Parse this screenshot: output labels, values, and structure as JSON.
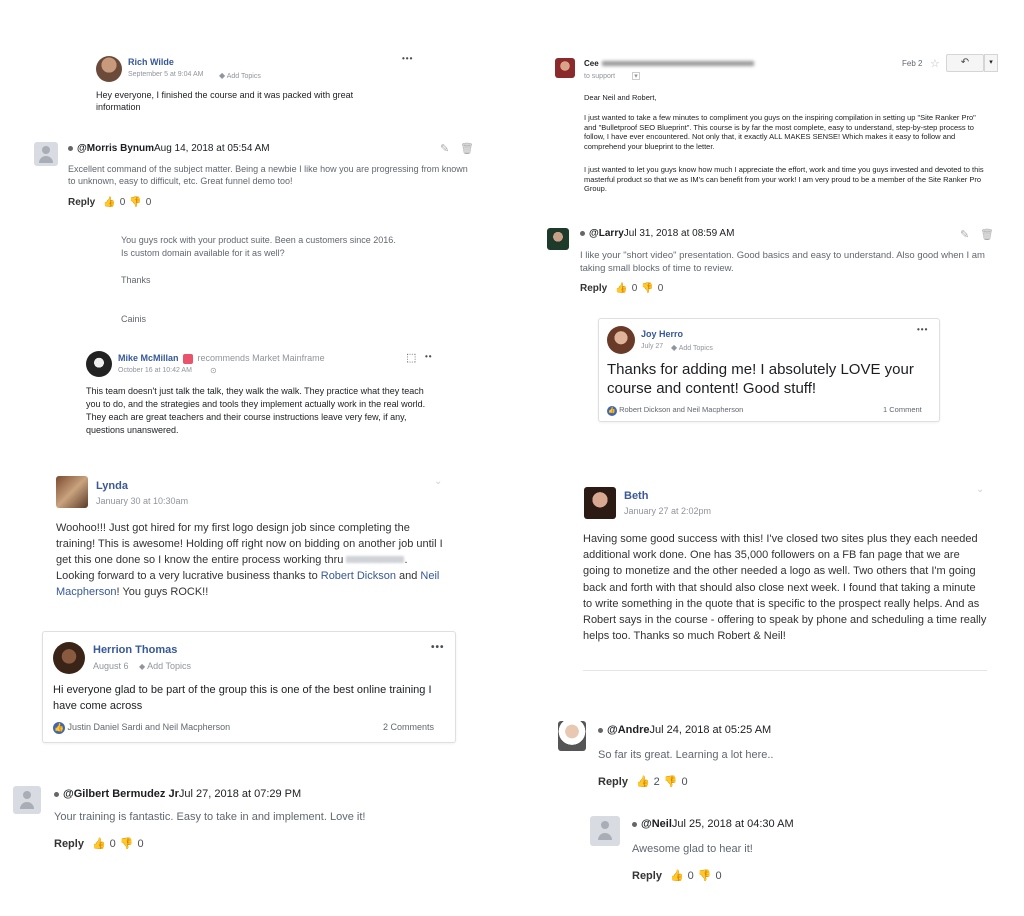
{
  "colors": {
    "fb_blue": "#365899",
    "meta_gray": "#90949c",
    "like_blue": "#4267b2"
  },
  "rich_wilde": {
    "name": "Rich Wilde",
    "date": "September 5 at 9:04 AM",
    "add_topics": "Add Topics",
    "menu": "•••",
    "body": "Hey everyone, I finished the course and it was packed with great information"
  },
  "morris": {
    "handle": "@Morris Bynum",
    "date": "Aug 14, 2018 at 05:54 AM",
    "body": "Excellent command of the subject matter. Being a newbie I like how you are progressing from known to unknown, easy to difficult, etc. Great funnel demo too!",
    "reply": "Reply",
    "likes": "0",
    "dislikes": "0"
  },
  "cainis": {
    "line1": "You guys rock with your product suite. Been a customers since 2016.",
    "line2": "Is custom domain available for it as well?",
    "thanks": "Thanks",
    "signature": "Cainis"
  },
  "mike": {
    "name": "Mike McMillan",
    "recommends": "recommends Market Mainframe",
    "date": "October 16 at 10:42 AM",
    "menu": "••",
    "body": "This team doesn't just talk the talk, they walk the walk. They practice what they teach you to do, and the strategies and tools they implement actually work in the real world. They each are great teachers and their course instructions leave very few, if any, questions unanswered."
  },
  "lynda": {
    "name": "Lynda",
    "date": "January 30 at 10:30am",
    "body_start": "Woohoo!!! Just got hired for my first logo design job since completing the training! This is awesome! Holding off right now on bidding on another job until I get this one done so I know the entire process working thru",
    "body_mid": ". Looking forward to a very lucrative business thanks to ",
    "link1": "Robert Dickson",
    "and": " and ",
    "link2": "Neil Macpherson",
    "body_end": "! You guys ROCK!!"
  },
  "herrion": {
    "name": "Herrion Thomas",
    "date": "August 6",
    "add_topics": "Add Topics",
    "menu": "•••",
    "body": "Hi everyone glad to be part of the group this is one of the best online training I have come across",
    "likers": "Justin Daniel Sardi and Neil Macpherson",
    "comments": "2 Comments"
  },
  "gilbert": {
    "handle": "@Gilbert Bermudez Jr",
    "date": "Jul 27, 2018 at 07:29 PM",
    "body": "Your training is fantastic. Easy to take in and implement. Love it!",
    "reply": "Reply",
    "likes": "0",
    "dislikes": "0"
  },
  "email": {
    "from": "Cee",
    "to": "to support",
    "date": "Feb 2",
    "greeting": "Dear Neil and Robert,",
    "para1": "I just wanted to take a few minutes to compliment you guys on the inspiring compilation in setting up \"Site Ranker Pro\" and \"Bulletproof SEO Blueprint\". This course is by far the most complete, easy to understand, step-by-step process to follow, I have ever encountered. Not only that, it exactly ALL MAKES SENSE! Which makes it easy to follow and comprehend your blueprint to the letter.",
    "para2": "I just wanted to let you guys know how much I appreciate the effort, work and time you guys invested and devoted to this masterful product so that we as IM's can benefit from your work! I am very proud to be a member of the Site Ranker Pro Group."
  },
  "larry": {
    "handle": "@Larry",
    "date": "Jul 31, 2018 at 08:59 AM",
    "body": "I like your \"short video\" presentation. Good basics and easy to understand. Also good when I am taking small blocks of time to review.",
    "reply": "Reply",
    "likes": "0",
    "dislikes": "0"
  },
  "joy": {
    "name": "Joy Herro",
    "date": "July 27",
    "add_topics": "Add Topics",
    "menu": "•••",
    "body": "Thanks for adding me! I absolutely LOVE your course and content! Good stuff!",
    "likers": "Robert Dickson and Neil Macpherson",
    "comments": "1 Comment"
  },
  "beth": {
    "name": "Beth",
    "date": "January 27 at 2:02pm",
    "body": "Having some good success with this! I've closed two sites plus they each needed additional work done. One has 35,000 followers on a FB fan page that we are going to monetize and the other needed a logo as well. Two others that I'm going back and forth with that should also close next week. I found that taking a minute to write something in the quote that is specific to the prospect really helps. And as Robert says in the course - offering to speak by phone and scheduling a time really helps too. Thanks so much Robert & Neil!"
  },
  "andre": {
    "handle": "@Andre",
    "date": "Jul 24, 2018 at 05:25 AM",
    "body": "So far its great. Learning a lot here..",
    "reply": "Reply",
    "likes": "2",
    "dislikes": "0"
  },
  "neil": {
    "handle": "@Neil",
    "date": "Jul 25, 2018 at 04:30 AM",
    "body": "Awesome glad to hear it!",
    "reply": "Reply",
    "likes": "0",
    "dislikes": "0"
  }
}
